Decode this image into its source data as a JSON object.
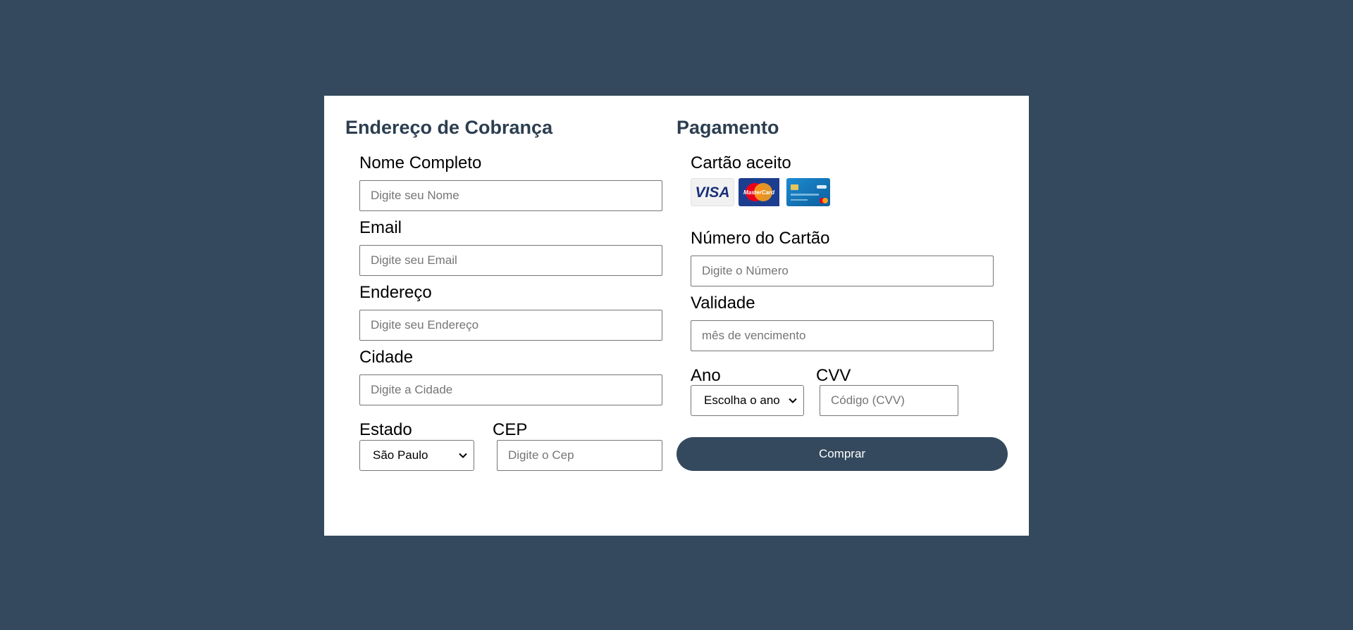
{
  "colors": {
    "background": "#34495e",
    "card": "#ffffff",
    "heading": "#2c3e50",
    "button": "#34495e",
    "button_text": "#ffffff"
  },
  "billing": {
    "title": "Endereço de Cobrança",
    "name": {
      "label": "Nome Completo",
      "placeholder": "Digite seu Nome"
    },
    "email": {
      "label": "Email",
      "placeholder": "Digite seu Email"
    },
    "address": {
      "label": "Endereço",
      "placeholder": "Digite seu Endereço"
    },
    "city": {
      "label": "Cidade",
      "placeholder": "Digite a Cidade"
    },
    "state": {
      "label": "Estado",
      "value": "São Paulo"
    },
    "zip": {
      "label": "CEP",
      "placeholder": "Digite o Cep"
    }
  },
  "payment": {
    "title": "Pagamento",
    "accepted_label": "Cartão aceito",
    "card_icons": [
      "visa-icon",
      "mastercard-icon",
      "credit-card-icon"
    ],
    "card_visa_text": "VISA",
    "card_mastercard_text": "MasterCard",
    "number": {
      "label": "Número do Cartão",
      "placeholder": "Digite o Número"
    },
    "expiry": {
      "label": "Validade",
      "placeholder": "mês de vencimento"
    },
    "year": {
      "label": "Ano",
      "value": "Escolha o ano"
    },
    "cvv": {
      "label": "CVV",
      "placeholder": "Código (CVV)"
    },
    "submit_label": "Comprar"
  }
}
